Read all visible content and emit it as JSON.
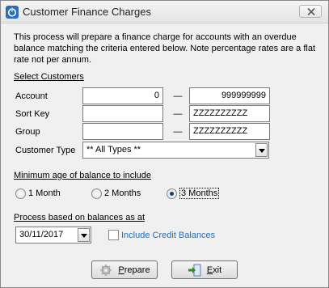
{
  "window": {
    "title": "Customer Finance Charges"
  },
  "intro": "This process will prepare a finance charge for accounts with an overdue balance matching the criteria entered below.  Note percentage rates are a flat rate not per annum.",
  "select_customers": {
    "heading": "Select Customers",
    "rows": [
      {
        "label": "Account",
        "from": "0",
        "to": "999999999"
      },
      {
        "label": "Sort Key",
        "from": "",
        "to": "ZZZZZZZZZZ"
      },
      {
        "label": "Group",
        "from": "",
        "to": "ZZZZZZZZZZ"
      }
    ],
    "dash": "—",
    "customer_type_label": "Customer Type",
    "customer_type_value": "** All Types **"
  },
  "min_age": {
    "heading": "Minimum age of balance to include",
    "options": [
      {
        "label": "1 Month",
        "selected": false
      },
      {
        "label": "2 Months",
        "selected": false
      },
      {
        "label": "3 Months",
        "selected": true
      }
    ]
  },
  "process_based": {
    "heading": "Process based on balances as at",
    "date": "30/11/2017",
    "include_credit_label": "Include Credit Balances",
    "include_credit_checked": false
  },
  "buttons": {
    "prepare_first": "P",
    "prepare_rest": "repare",
    "exit_first": "E",
    "exit_rest": "xit"
  },
  "colors": {
    "accent": "#1f6fc5",
    "icon_blue": "#2b6cb3"
  }
}
